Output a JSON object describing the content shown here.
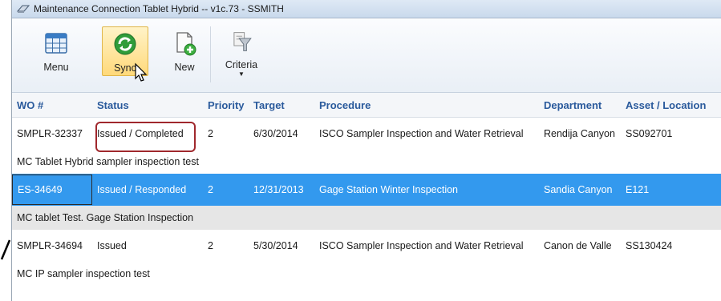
{
  "window": {
    "title": "Maintenance Connection Tablet Hybrid  --  v1c.73  - SSMITH"
  },
  "toolbar": {
    "buttons": [
      {
        "label": "Menu",
        "icon": "grid-calendar-icon"
      },
      {
        "label": "Sync",
        "icon": "sync-arrows-icon"
      },
      {
        "label": "New",
        "icon": "new-document-icon"
      },
      {
        "label": "Criteria",
        "icon": "filter-funnel-icon"
      }
    ]
  },
  "grid": {
    "columns": [
      "WO #",
      "Status",
      "Priority",
      "Target",
      "Procedure",
      "Department",
      "Asset / Location"
    ],
    "rows": [
      {
        "wo": "SMPLR-32337",
        "status": "Issued / Completed",
        "priority": "2",
        "target": "6/30/2014",
        "procedure": "ISCO Sampler Inspection and Water Retrieval",
        "department": "Rendija Canyon",
        "asset": "SS092701",
        "description": "MC Tablet Hybrid sampler inspection  test"
      },
      {
        "wo": "ES-34649",
        "status": "Issued / Responded",
        "priority": "2",
        "target": "12/31/2013",
        "procedure": "Gage Station Winter Inspection",
        "department": "Sandia Canyon",
        "asset": "E121",
        "description": "MC tablet Test. Gage Station Inspection"
      },
      {
        "wo": "SMPLR-34694",
        "status": "Issued",
        "priority": "2",
        "target": "5/30/2014",
        "procedure": "ISCO Sampler Inspection and Water Retrieval",
        "department": "Canon de Valle",
        "asset": "SS130424",
        "description": "MC IP sampler inspection test"
      }
    ]
  },
  "colors": {
    "selection": "#3399ee",
    "header_text": "#2a5a9c",
    "highlight_border": "#a0282d"
  }
}
